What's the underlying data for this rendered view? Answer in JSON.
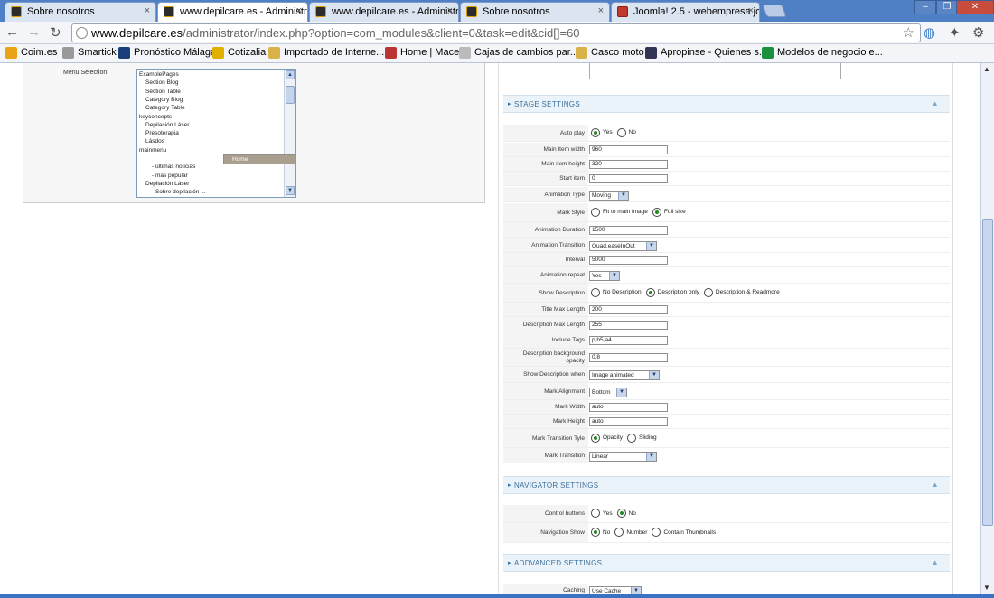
{
  "browser": {
    "tabs": [
      {
        "title": "Sobre nosotros",
        "active": false,
        "icon": "joomla-icon"
      },
      {
        "title": "www.depilcare.es - Administra",
        "active": true,
        "icon": "joomla-icon"
      },
      {
        "title": "www.depilcare.es - Administra",
        "active": false,
        "icon": "joomla-icon"
      },
      {
        "title": "Sobre nosotros",
        "active": false,
        "icon": "joomla-icon"
      },
      {
        "title": "Joomla! 2.5 - webempresa joo",
        "active": false,
        "icon": "webempresa-icon"
      }
    ],
    "close_glyph": "×",
    "url_host": "www.depilcare.es",
    "url_path": "/administrator/index.php?option=com_modules&client=0&task=edit&cid[]=60"
  },
  "bookmarks": [
    {
      "label": "Coim.es"
    },
    {
      "label": "Smartick"
    },
    {
      "label": "Pronóstico Málaga"
    },
    {
      "label": "Cotizalia"
    },
    {
      "label": "Importado de Interne..."
    },
    {
      "label": "Home | Mace"
    },
    {
      "label": "Cajas de cambios par..."
    },
    {
      "label": "Casco moto"
    },
    {
      "label": "Apropinse - Quienes s..."
    },
    {
      "label": "Modelos de negocio e..."
    }
  ],
  "menu_selection": {
    "label": "Menu Selection:",
    "items": [
      {
        "text": "ExamplePages",
        "indent": 0
      },
      {
        "text": "Section Blog",
        "indent": 1
      },
      {
        "text": "Section Table",
        "indent": 1
      },
      {
        "text": "Category Blog",
        "indent": 1
      },
      {
        "text": "Category Table",
        "indent": 1
      },
      {
        "text": "keyconcepts",
        "indent": 0
      },
      {
        "text": "Depilación Láser",
        "indent": 1
      },
      {
        "text": "Presoterapia",
        "indent": 1
      },
      {
        "text": "Lásdos",
        "indent": 1
      },
      {
        "text": "mainmenu",
        "indent": 0
      },
      {
        "text": "Home",
        "indent": 1,
        "selected": true
      },
      {
        "text": "- últimas noticias",
        "indent": 2
      },
      {
        "text": "- más popular",
        "indent": 2
      },
      {
        "text": "Depilación Láser",
        "indent": 1
      },
      {
        "text": "- Sobre depilación ...",
        "indent": 2
      }
    ]
  },
  "stage_settings": {
    "title": "STAGE SETTINGS",
    "rows": [
      {
        "label": "Auto play",
        "type": "radio",
        "options": [
          {
            "t": "Yes",
            "on": true
          },
          {
            "t": "No",
            "on": false
          }
        ]
      },
      {
        "label": "Main Item width",
        "type": "input",
        "value": "960"
      },
      {
        "label": "Main item height",
        "type": "input",
        "value": "320"
      },
      {
        "label": "Start item",
        "type": "input",
        "value": "0"
      },
      {
        "label": "Animation Type",
        "type": "select",
        "value": "Moving",
        "w": 44
      },
      {
        "label": "Mark Style",
        "type": "radio",
        "options": [
          {
            "t": "Fit to main image",
            "on": false
          },
          {
            "t": "Full size",
            "on": true
          }
        ]
      },
      {
        "label": "Animation Duration",
        "type": "input",
        "value": "1500"
      },
      {
        "label": "Animation Transition",
        "type": "select",
        "value": "Quad.easeInOut",
        "w": 75
      },
      {
        "label": "Interval",
        "type": "input",
        "value": "5000"
      },
      {
        "label": "Animation repeat",
        "type": "select",
        "value": "Yes",
        "w": 34
      },
      {
        "label": "Show Description",
        "type": "radio",
        "options": [
          {
            "t": "No Description",
            "on": false
          },
          {
            "t": "Description only",
            "on": true
          },
          {
            "t": "Description & Readmore",
            "on": false
          }
        ]
      },
      {
        "label": "Title Max Length",
        "type": "input",
        "value": "200"
      },
      {
        "label": "Description Max Length",
        "type": "input",
        "value": "255"
      },
      {
        "label": "Include Tags",
        "type": "input",
        "value": "p,b5,a4"
      },
      {
        "label": "Description background opacity",
        "type": "input",
        "value": "0.8"
      },
      {
        "label": "Show Description when",
        "type": "select",
        "value": "Image animated",
        "w": 78
      },
      {
        "label": "Mark Alignment",
        "type": "select",
        "value": "Bottom",
        "w": 42
      },
      {
        "label": "Mark Width",
        "type": "input",
        "value": "auto"
      },
      {
        "label": "Mark Height",
        "type": "input",
        "value": "auto"
      },
      {
        "label": "Mark Transition Tyle",
        "type": "radio",
        "options": [
          {
            "t": "Opacity",
            "on": true
          },
          {
            "t": "Sliding",
            "on": false
          }
        ]
      },
      {
        "label": "Mark Transition",
        "type": "select",
        "value": "Linear",
        "w": 75
      }
    ]
  },
  "navigator_settings": {
    "title": "NAVIGATOR SETTINGS",
    "rows": [
      {
        "label": "Control buttons",
        "type": "radio",
        "options": [
          {
            "t": "Yes",
            "on": false
          },
          {
            "t": "No",
            "on": true
          }
        ]
      },
      {
        "label": "Navigation Show",
        "type": "radio",
        "options": [
          {
            "t": "No",
            "on": true
          },
          {
            "t": "Number",
            "on": false
          },
          {
            "t": "Contain Thumbnails",
            "on": false
          }
        ]
      }
    ]
  },
  "advanced_settings": {
    "title": "ADDVANCED SETTINGS",
    "rows": [
      {
        "label": "Caching",
        "type": "select",
        "value": "Use Cache",
        "w": 58
      }
    ]
  }
}
